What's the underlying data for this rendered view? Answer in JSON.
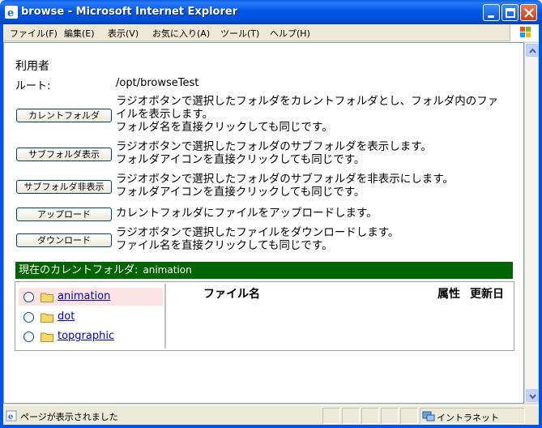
{
  "window": {
    "title": "browse - Microsoft Internet Explorer"
  },
  "menu": {
    "items": [
      "ファイル(F)",
      "編集(E)",
      "表示(V)",
      "お気に入り(A)",
      "ツール(T)",
      "ヘルプ(H)"
    ]
  },
  "page": {
    "user_label": "利用者",
    "root_label": "ルート:",
    "root_value": "/opt/browseTest",
    "actions": [
      {
        "button": "カレントフォルダ",
        "lines": [
          "ラジオボタンで選択したフォルダをカレントフォルダとし、フォルダ内のファ",
          "イルを表示します。",
          "フォルダ名を直接クリックしても同じです。"
        ]
      },
      {
        "button": "サブフォルダ表示",
        "lines": [
          "ラジオボタンで選択したフォルダのサブフォルダを表示します。",
          "フォルダアイコンを直接クリックしても同じです。"
        ]
      },
      {
        "button": "サブフォルダ非表示",
        "lines": [
          "ラジオボタンで選択したフォルダのサブフォルダを非表示にします。",
          "フォルダアイコンを直接クリックしても同じです。"
        ]
      },
      {
        "button": "アップロード",
        "lines": [
          "カレントフォルダにファイルをアップロードします。"
        ]
      },
      {
        "button": "ダウンロード",
        "lines": [
          "ラジオボタンで選択したファイルをダウンロードします。",
          "ファイル名を直接クリックしても同じです。"
        ]
      }
    ],
    "current_folder_label": "現在のカレントフォルダ:",
    "current_folder_value": "animation",
    "folders": [
      "animation",
      "dot",
      "topgraphic"
    ],
    "file_columns": {
      "name": "ファイル名",
      "attr": "属性",
      "updated": "更新日"
    }
  },
  "status": {
    "text": "ページが表示されました",
    "zone": "イントラネット"
  },
  "colors": {
    "current_bar": "#006400",
    "selected_row": "#fde4e4",
    "link": "#0000cc"
  }
}
